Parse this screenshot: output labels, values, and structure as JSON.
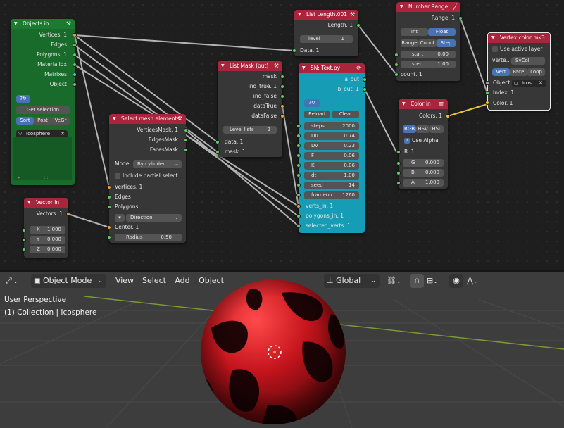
{
  "objects_in": {
    "title": "Objects in",
    "outputs": [
      "Vertices. 1",
      "Edges",
      "Polygons. 1",
      "MaterialIdx",
      "Matrixes",
      "Object"
    ],
    "get_selection": "Get selection",
    "tabs": [
      "Sort",
      "Post",
      "VeGr"
    ],
    "object": "Icosphere"
  },
  "select_mesh": {
    "title": "Select mesh elements",
    "outputs": [
      "VerticesMask. 1",
      "EdgesMask",
      "FacesMask"
    ],
    "mode_label": "Mode:",
    "mode_value": "By cylinder",
    "include_partial": "Include partial select...",
    "inputs": [
      "Vertices. 1",
      "Edges",
      "Polygons"
    ],
    "direction": "Direction",
    "center": "Center. 1",
    "radius_label": "Radius",
    "radius_value": "0.50"
  },
  "vector_in": {
    "title": "Vector in",
    "output": "Vectors. 1",
    "fields": [
      {
        "l": "X",
        "v": "1.000"
      },
      {
        "l": "Y",
        "v": "0.000"
      },
      {
        "l": "Z",
        "v": "0.000"
      }
    ]
  },
  "list_mask": {
    "title": "List Mask (out)",
    "outputs": [
      "mask",
      "ind_true. 1",
      "ind_false",
      "dataTrue",
      "dataFalse"
    ],
    "level_label": "Level lists",
    "level_value": "2",
    "inputs": [
      "data. 1",
      "mask. 1"
    ]
  },
  "list_length": {
    "title": "List Length.001",
    "output": "Length. 1",
    "level_label": "level",
    "level_value": "1",
    "input": "Data. 1"
  },
  "sn_text": {
    "title": "SN: Text.py",
    "outputs": [
      "a_out",
      "b_out. 1"
    ],
    "reload": "Reload",
    "clear": "Clear",
    "params": [
      {
        "l": "steps",
        "v": "2000"
      },
      {
        "l": "Du",
        "v": "0.74"
      },
      {
        "l": "Dv",
        "v": "0.23"
      },
      {
        "l": "F",
        "v": "0.06"
      },
      {
        "l": "K",
        "v": "0.06"
      },
      {
        "l": "dt",
        "v": "1.00"
      },
      {
        "l": "seed",
        "v": "14"
      },
      {
        "l": "framenu",
        "v": "1260"
      }
    ],
    "inputs": [
      "verts_in. 1",
      "polygons_in. 1",
      "selected_verts. 1"
    ]
  },
  "number_range": {
    "title": "Number Range",
    "output": "Range. 1",
    "types": [
      "Int",
      "Float"
    ],
    "modes": [
      "Range",
      "Count",
      "Step"
    ],
    "fields": [
      {
        "l": "start",
        "v": "0.00"
      },
      {
        "l": "step",
        "v": "1.00"
      }
    ],
    "input": "count. 1"
  },
  "color_in": {
    "title": "Color in",
    "output": "Colors. 1",
    "modes": [
      "RGB",
      "HSV",
      "HSL"
    ],
    "use_alpha": "Use Alpha",
    "input": "R. 1",
    "fields": [
      {
        "l": "G",
        "v": "0.000"
      },
      {
        "l": "B",
        "v": "0.000"
      },
      {
        "l": "A",
        "v": "1.000"
      }
    ]
  },
  "vertex_color": {
    "title": "Vertex color mk3",
    "use_active": "Use active layer",
    "layer_label": "verte...",
    "layer_value": "SvCol",
    "modes": [
      "Vert",
      "Face",
      "Loop"
    ],
    "inputs": [
      "Object",
      "Index. 1",
      "Color. 1"
    ],
    "object_value": "Icos"
  },
  "viewport": {
    "mode": "Object Mode",
    "menus": [
      "View",
      "Select",
      "Add",
      "Object"
    ],
    "orientation": "Global",
    "perspective": "User Perspective",
    "collection": "(1) Collection | Icosphere"
  }
}
